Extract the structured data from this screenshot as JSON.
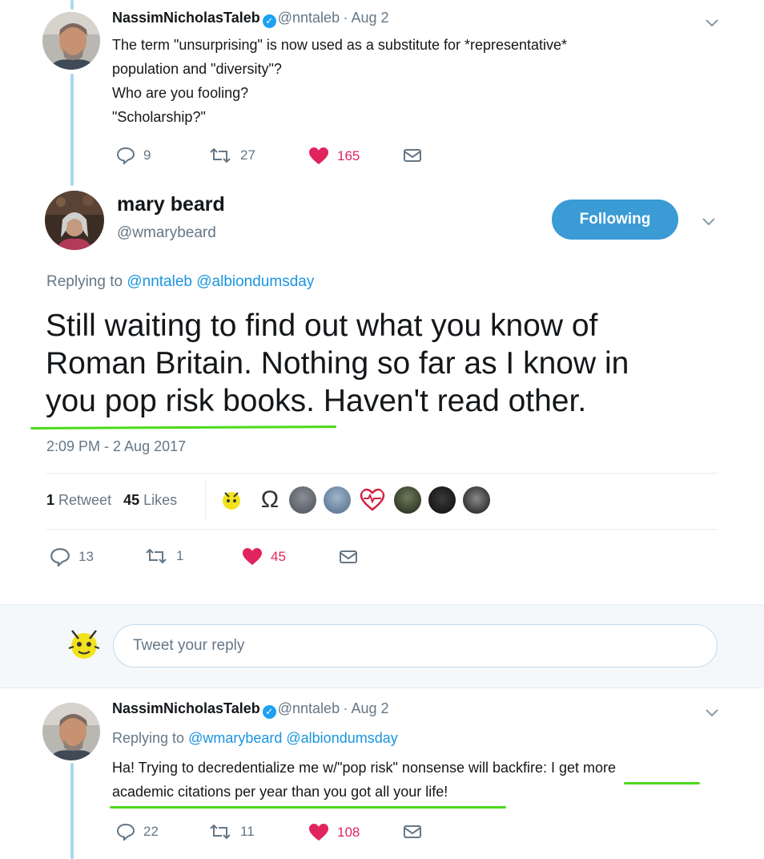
{
  "tweet1": {
    "name": "NassimNicholasTaleb",
    "handle": "@nntaleb",
    "date": "· Aug 2",
    "lines": [
      "The term \"unsurprising\" is now used as a substitute for *representative*",
      "population and \"diversity\"?",
      "Who are you fooling?",
      "\"Scholarship?\""
    ],
    "replies": "9",
    "retweets": "27",
    "likes": "165"
  },
  "main": {
    "name": "mary beard",
    "handle": "@wmarybeard",
    "follow_label": "Following",
    "replying_prefix": "Replying to",
    "replying_handles": "@nntaleb @albiondumsday",
    "text_lines": [
      "Still waiting to find out what you know of",
      "Roman Britain. Nothing so far as I know in",
      "you pop risk books. Haven't read other."
    ],
    "timestamp": "2:09 PM - 2 Aug 2017",
    "retweet_count": "1",
    "retweet_label": "Retweet",
    "like_count": "45",
    "like_label": "Likes",
    "replies": "13",
    "retweets": "1",
    "likes": "45"
  },
  "reply_box": {
    "placeholder": "Tweet your reply"
  },
  "tweet3": {
    "name": "NassimNicholasTaleb",
    "handle": "@nntaleb",
    "date": "· Aug 2",
    "replying_prefix": "Replying to",
    "replying_handles": "@wmarybeard @albiondumsday",
    "lines": [
      "Ha! Trying to decredentialize me w/\"pop risk\" nonsense will backfire: I get more",
      "academic citations per year than you got all your life!"
    ],
    "replies": "22",
    "retweets": "11",
    "likes": "108"
  },
  "colors": {
    "accent": "#1da1f2",
    "like": "#e0245e",
    "highlight": "#4cd919"
  }
}
